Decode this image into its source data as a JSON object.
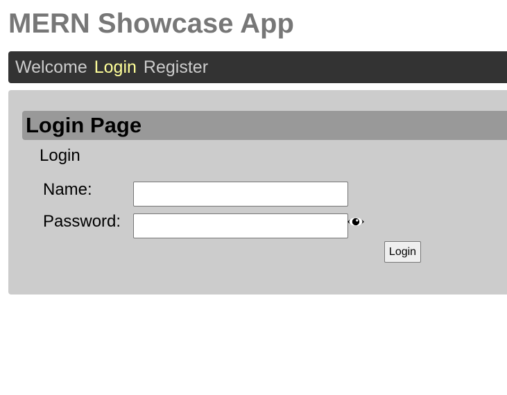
{
  "app": {
    "title": "MERN Showcase App"
  },
  "nav": {
    "items": [
      {
        "label": "Welcome",
        "active": false
      },
      {
        "label": "Login",
        "active": true
      },
      {
        "label": "Register",
        "active": false
      }
    ]
  },
  "page": {
    "title": "Login Page",
    "section_label": "Login"
  },
  "form": {
    "name_label": "Name:",
    "name_value": "",
    "password_label": "Password:",
    "password_value": "",
    "password_toggle_icon": "eye-icon",
    "submit_label": "Login"
  },
  "colors": {
    "title": "#777777",
    "navbar_bg": "#333333",
    "nav_link": "#cccccc",
    "nav_active": "#ffff99",
    "panel_bg": "#cccccc",
    "header_bg": "#999999"
  }
}
